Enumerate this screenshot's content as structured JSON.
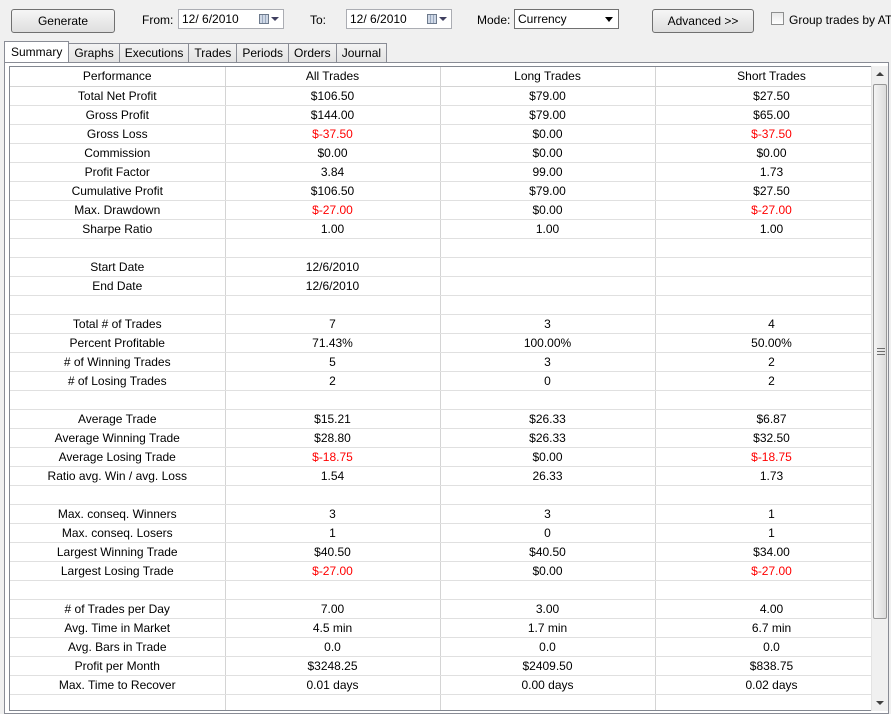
{
  "toolbar": {
    "generate_label": "Generate",
    "from_label": "From:",
    "from_date": "12/ 6/2010",
    "to_label": "To:",
    "to_date": "12/ 6/2010",
    "mode_label": "Mode:",
    "mode_value": "Currency",
    "advanced_label": "Advanced >>",
    "group_trades_label": "Group trades by ATM"
  },
  "tabs": [
    "Summary",
    "Graphs",
    "Executions",
    "Trades",
    "Periods",
    "Orders",
    "Journal"
  ],
  "active_tab": "Summary",
  "colors": {
    "negative": "#ff0000"
  },
  "table": {
    "columns": [
      "Performance",
      "All Trades",
      "Long Trades",
      "Short Trades"
    ],
    "rows": [
      [
        "Total Net Profit",
        "$106.50",
        "$79.00",
        "$27.50"
      ],
      [
        "Gross Profit",
        "$144.00",
        "$79.00",
        "$65.00"
      ],
      [
        "Gross Loss",
        "$-37.50",
        "$0.00",
        "$-37.50"
      ],
      [
        "Commission",
        "$0.00",
        "$0.00",
        "$0.00"
      ],
      [
        "Profit Factor",
        "3.84",
        "99.00",
        "1.73"
      ],
      [
        "Cumulative Profit",
        "$106.50",
        "$79.00",
        "$27.50"
      ],
      [
        "Max. Drawdown",
        "$-27.00",
        "$0.00",
        "$-27.00"
      ],
      [
        "Sharpe Ratio",
        "1.00",
        "1.00",
        "1.00"
      ],
      [
        "",
        "",
        "",
        ""
      ],
      [
        "Start Date",
        "12/6/2010",
        "",
        ""
      ],
      [
        "End Date",
        "12/6/2010",
        "",
        ""
      ],
      [
        "",
        "",
        "",
        ""
      ],
      [
        "Total # of Trades",
        "7",
        "3",
        "4"
      ],
      [
        "Percent Profitable",
        "71.43%",
        "100.00%",
        "50.00%"
      ],
      [
        "# of Winning Trades",
        "5",
        "3",
        "2"
      ],
      [
        "# of Losing Trades",
        "2",
        "0",
        "2"
      ],
      [
        "",
        "",
        "",
        ""
      ],
      [
        "Average Trade",
        "$15.21",
        "$26.33",
        "$6.87"
      ],
      [
        "Average Winning Trade",
        "$28.80",
        "$26.33",
        "$32.50"
      ],
      [
        "Average Losing Trade",
        "$-18.75",
        "$0.00",
        "$-18.75"
      ],
      [
        "Ratio avg. Win / avg. Loss",
        "1.54",
        "26.33",
        "1.73"
      ],
      [
        "",
        "",
        "",
        ""
      ],
      [
        "Max. conseq. Winners",
        "3",
        "3",
        "1"
      ],
      [
        "Max. conseq. Losers",
        "1",
        "0",
        "1"
      ],
      [
        "Largest Winning Trade",
        "$40.50",
        "$40.50",
        "$34.00"
      ],
      [
        "Largest Losing Trade",
        "$-27.00",
        "$0.00",
        "$-27.00"
      ],
      [
        "",
        "",
        "",
        ""
      ],
      [
        "# of Trades per Day",
        "7.00",
        "3.00",
        "4.00"
      ],
      [
        "Avg. Time in Market",
        "4.5 min",
        "1.7 min",
        "6.7 min"
      ],
      [
        "Avg. Bars in Trade",
        "0.0",
        "0.0",
        "0.0"
      ],
      [
        "Profit per Month",
        "$3248.25",
        "$2409.50",
        "$838.75"
      ],
      [
        "Max. Time to Recover",
        "0.01 days",
        "0.00 days",
        "0.02 days"
      ],
      [
        "",
        "",
        "",
        ""
      ]
    ]
  }
}
